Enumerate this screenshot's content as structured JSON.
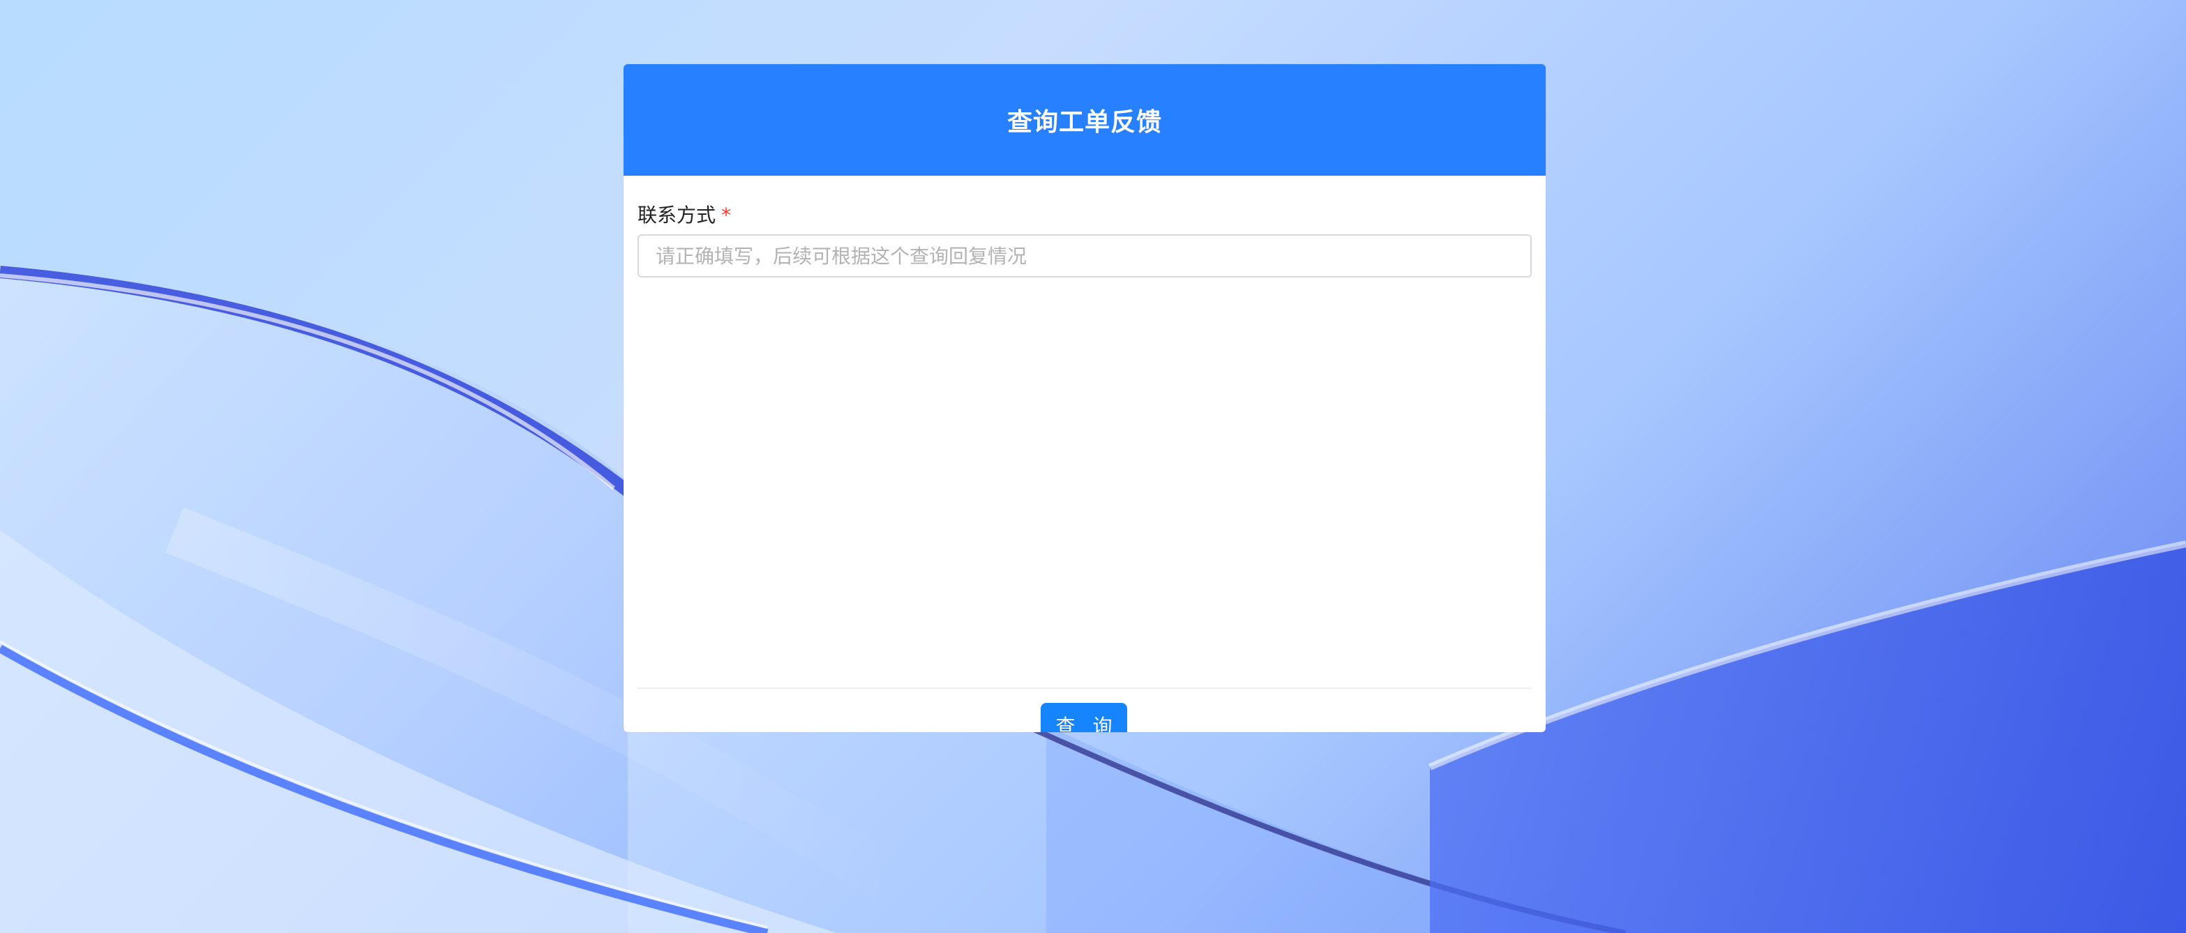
{
  "page": {
    "title": "查询工单反馈"
  },
  "form": {
    "contact": {
      "label": "联系方式",
      "required_mark": "*",
      "placeholder": "请正确填写，后续可根据这个查询回复情况",
      "value": ""
    }
  },
  "actions": {
    "query_label": "查 询"
  },
  "colors": {
    "header": "#2680ff",
    "button": "#1684fc",
    "required": "#ff3b30"
  }
}
